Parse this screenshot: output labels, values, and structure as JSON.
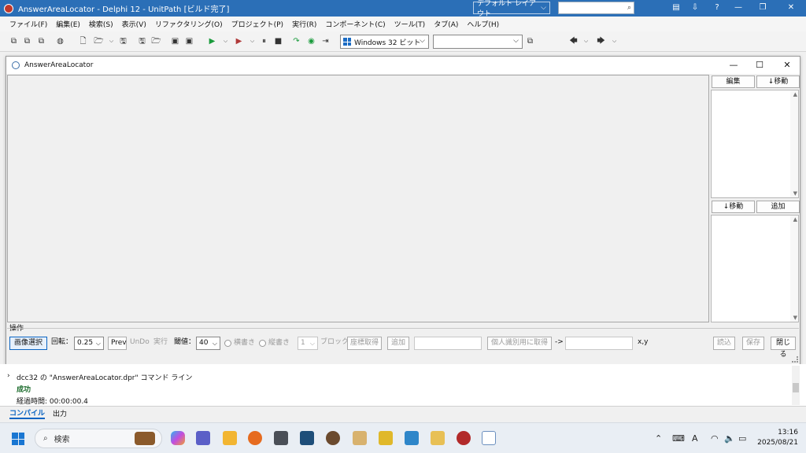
{
  "ide": {
    "title": "AnswerAreaLocator - Delphi 12 - UnitPath [ビルド完了]",
    "layout": "デフォルト レイアウト",
    "menu": [
      "ファイル(F)",
      "編集(E)",
      "検索(S)",
      "表示(V)",
      "リファクタリング(O)",
      "プロジェクト(P)",
      "実行(R)",
      "コンポーネント(C)",
      "ツール(T)",
      "タブ(A)",
      "ヘルプ(H)"
    ],
    "platform": "Windows 32 ビット"
  },
  "form": {
    "title": "AnswerAreaLocator",
    "upper_list": {
      "edit_label": "編集",
      "move_down_label": "↓移動"
    },
    "lower_list": {
      "move_down_label": "↓移動",
      "add_label": "追加"
    },
    "ops": {
      "group_label": "操作",
      "select_image": "画像選択",
      "rotate_label": "回転：",
      "rotate_value": "0.25",
      "prev": "Prev",
      "undo": "UnDo",
      "run": "実行",
      "threshold_label": "閾値：",
      "threshold_value": "40",
      "horizontal": "横書き",
      "vertical": "縦書き",
      "block_count": "1",
      "block_label": "ブロック",
      "get_coords": "座標取得",
      "add": "追加",
      "get_for_personal_id": "個人識別用に取得",
      "arrow": "->",
      "xy": "x,y",
      "load": "読込",
      "save": "保存",
      "close": "閉じる"
    }
  },
  "messages": {
    "lines": [
      "dcc32 の \"AnswerAreaLocator.dpr\" コマンド ライン",
      "成功",
      "経過時間: 00:00:00.4"
    ],
    "tabs": [
      "コンパイル",
      "出力"
    ]
  },
  "taskbar": {
    "search_label": "検索",
    "time": "13:16",
    "date": "2025/08/21",
    "ime": "A"
  }
}
